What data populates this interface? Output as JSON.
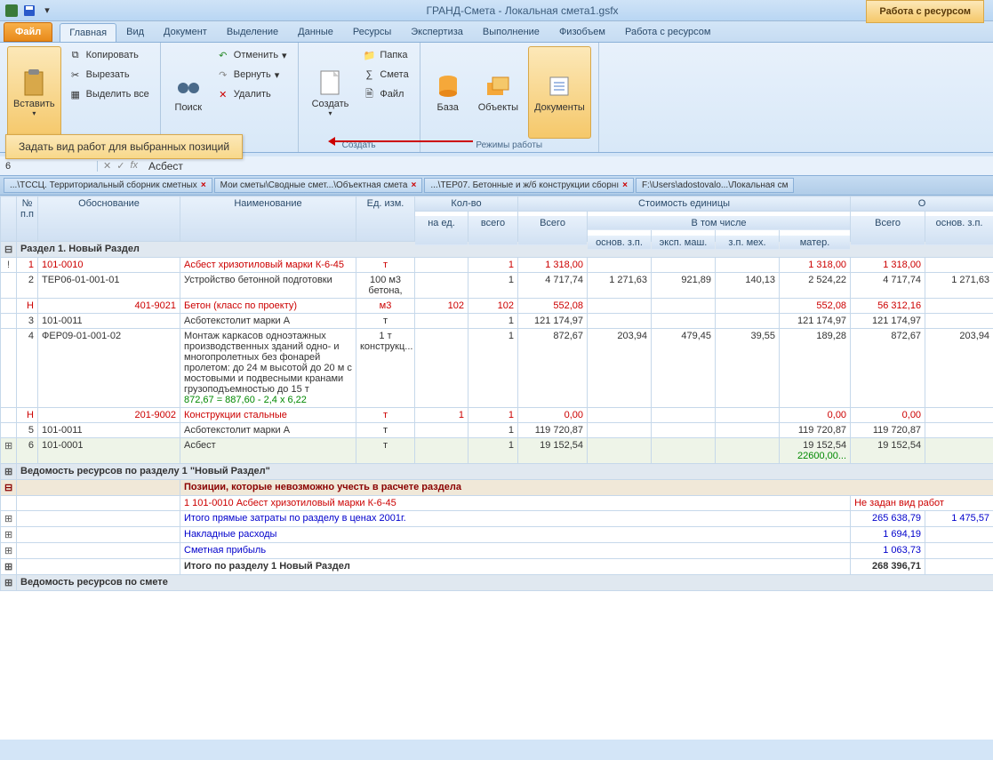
{
  "title": "ГРАНД-Смета - Локальная смета1.gsfx",
  "highlight_tab": "Работа с ресурсом",
  "file_btn": "Файл",
  "tabs": [
    "Главная",
    "Вид",
    "Документ",
    "Выделение",
    "Данные",
    "Ресурсы",
    "Экспертиза",
    "Выполнение",
    "Физобъем",
    "Работа с ресурсом"
  ],
  "active_tab": 0,
  "ribbon": {
    "paste": "Вставить",
    "copy": "Копировать",
    "cut": "Вырезать",
    "select_all": "Выделить все",
    "search": "Поиск",
    "undo": "Отменить",
    "redo": "Вернуть",
    "delete": "Удалить",
    "create": "Создать",
    "create_group": "Создать",
    "folder": "Папка",
    "estimate": "Смета",
    "file": "Файл",
    "base": "База",
    "objects": "Объекты",
    "documents": "Документы",
    "modes": "Режимы работы"
  },
  "callout": "Задать вид работ для выбранных позиций",
  "formula": {
    "name": "6",
    "content": "Асбест"
  },
  "doc_tabs": [
    "...\\ТССЦ. Территориальный сборник сметных",
    "Мои сметы\\Сводные смет...\\Объектная смета",
    "...\\ТЕР07. Бетонные и ж/б конструкции сборнı",
    "F:\\Users\\adostovalo...\\Локальная см"
  ],
  "headers": {
    "num": "№ п.п",
    "obos": "Обоснование",
    "naim": "Наименование",
    "ed": "Ед. изм.",
    "kol": "Кол-во",
    "na_ed": "на ед.",
    "vsego": "всего",
    "cost_unit": "Стоимость единицы",
    "vsego2": "Всего",
    "vtom": "В том числе",
    "osn": "основ. з.п.",
    "eksp": "эксп. маш.",
    "zpmex": "з.п. мех.",
    "mater": "матер.",
    "o_label": "О"
  },
  "section1": "Раздел 1. Новый Раздел",
  "rows": [
    {
      "exp": "!",
      "n": "1",
      "obos": "101-0010",
      "naim": "Асбест хризотиловый марки К-6-45",
      "ed": "т",
      "k1": "",
      "k2": "1",
      "vs": "1 318,00",
      "oz": "",
      "em": "",
      "zm": "",
      "mat": "1 318,00",
      "vs2": "1 318,00",
      "oz2": "",
      "cls": "red"
    },
    {
      "exp": "",
      "n": "2",
      "obos": "ТЕР06-01-001-01",
      "naim": "Устройство бетонной подготовки",
      "ed": "100 м3 бетона,",
      "k1": "",
      "k2": "1",
      "vs": "4 717,74",
      "oz": "1 271,63",
      "em": "921,89",
      "zm": "140,13",
      "mat": "2 524,22",
      "vs2": "4 717,74",
      "oz2": "1 271,63",
      "cls": ""
    },
    {
      "exp": "",
      "n": "Н",
      "obos": "401-9021",
      "naim": "Бетон (класс по проекту)",
      "ed": "м3",
      "k1": "102",
      "k2": "102",
      "vs": "552,08",
      "oz": "",
      "em": "",
      "zm": "",
      "mat": "552,08",
      "vs2": "56 312,16",
      "oz2": "",
      "cls": "red",
      "obos_right": true
    },
    {
      "exp": "",
      "n": "3",
      "obos": "101-0011",
      "naim": "Асботекстолит марки А",
      "ed": "т",
      "k1": "",
      "k2": "1",
      "vs": "121 174,97",
      "oz": "",
      "em": "",
      "zm": "",
      "mat": "121 174,97",
      "vs2": "121 174,97",
      "oz2": "",
      "cls": ""
    },
    {
      "exp": "",
      "n": "4",
      "obos": "ФЕР09-01-001-02",
      "naim": "Монтаж каркасов одноэтажных производственных зданий одно- и многопролетных без фонарей пролетом: до 24 м высотой до 20 м с мостовыми и подвесными кранами грузоподъемностью до 15 т",
      "naim2": "872,67 = 887,60 - 2,4 x 6,22",
      "ed": "1 т конструкц...",
      "k1": "",
      "k2": "1",
      "vs": "872,67",
      "oz": "203,94",
      "em": "479,45",
      "zm": "39,55",
      "mat": "189,28",
      "vs2": "872,67",
      "oz2": "203,94",
      "cls": ""
    },
    {
      "exp": "",
      "n": "Н",
      "obos": "201-9002",
      "naim": "Конструкции стальные",
      "ed": "т",
      "k1": "1",
      "k2": "1",
      "vs": "0,00",
      "oz": "",
      "em": "",
      "zm": "",
      "mat": "0,00",
      "vs2": "0,00",
      "oz2": "",
      "cls": "red",
      "obos_right": true
    },
    {
      "exp": "",
      "n": "5",
      "obos": "101-0011",
      "naim": "Асботекстолит марки А",
      "ed": "т",
      "k1": "",
      "k2": "1",
      "vs": "119 720,87",
      "oz": "",
      "em": "",
      "zm": "",
      "mat": "119 720,87",
      "vs2": "119 720,87",
      "oz2": "",
      "cls": ""
    },
    {
      "exp": "⊞",
      "n": "6",
      "obos": "101-0001",
      "naim": "Асбест",
      "ed": "т",
      "k1": "",
      "k2": "1",
      "vs": "19 152,54",
      "oz": "",
      "em": "",
      "zm": "",
      "mat": "19 152,54",
      "mat2": "22600,00...",
      "vs2": "19 152,54",
      "oz2": "",
      "cls": "",
      "hilite": true
    }
  ],
  "vedomost": "Ведомость ресурсов по разделу 1 \"Новый Раздел\"",
  "pos_error": "Позиции, которые невозможно учесть в расчете раздела",
  "err1": "1 101-0010 Асбест хризотиловый марки К-6-45",
  "err1_right": "Не задан вид работ",
  "totals": [
    {
      "label": "Итого прямые затраты по разделу в ценах 2001г.",
      "v1": "265 638,79",
      "v2": "1 475,57"
    },
    {
      "label": "Накладные расходы",
      "v1": "1 694,19",
      "v2": ""
    },
    {
      "label": "Сметная прибыль",
      "v1": "1 063,73",
      "v2": ""
    }
  ],
  "grand_total": {
    "label": "Итого по разделу 1 Новый Раздел",
    "v1": "268 396,71"
  },
  "vedomost_smeta": "Ведомость ресурсов по смете"
}
